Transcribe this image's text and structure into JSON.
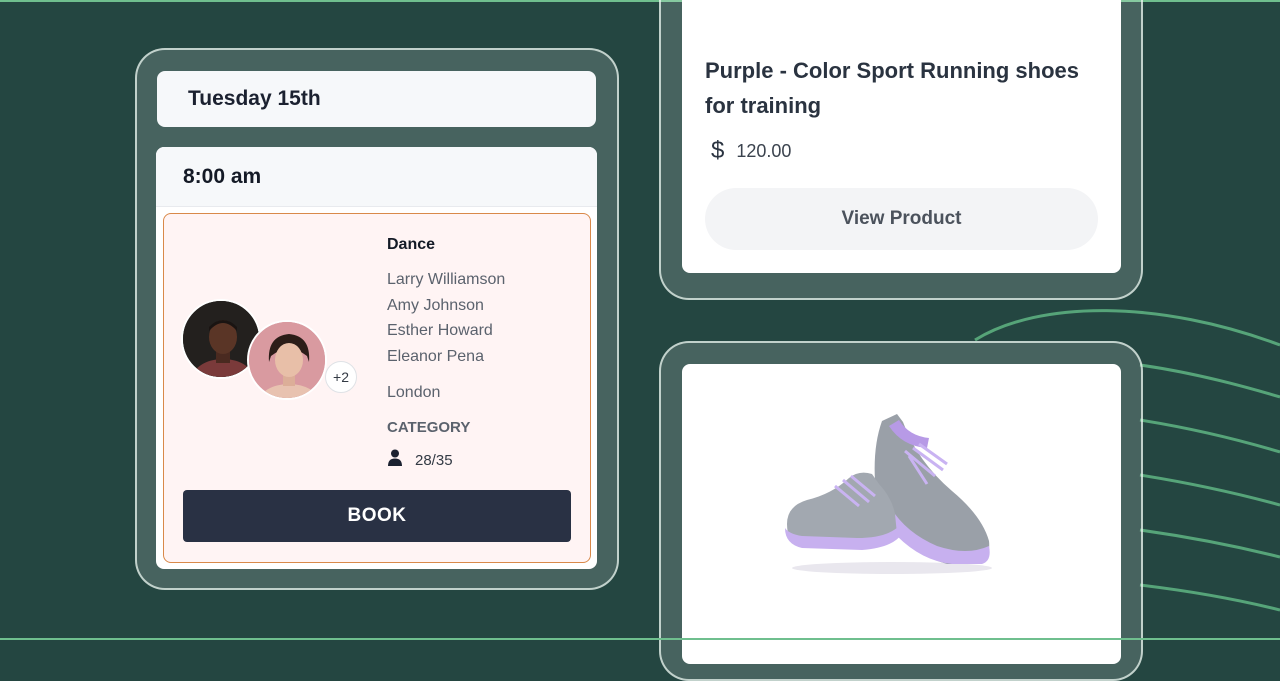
{
  "schedule": {
    "date": "Tuesday 15th",
    "time": "8:00 am",
    "session": {
      "title": "Dance",
      "instructors": [
        "Larry Williamson",
        "Amy Johnson",
        "Esther Howard",
        "Eleanor Pena"
      ],
      "location": "London",
      "category_label": "CATEGORY",
      "capacity": "28/35",
      "more_count": "+2",
      "book_label": "BOOK"
    }
  },
  "product": {
    "title": "Purple - Color Sport Running shoes for training",
    "price": "120.00",
    "view_label": "View Product",
    "image_icon": "running-shoes"
  },
  "colors": {
    "background": "#244641",
    "accent_line": "#6fbf8e",
    "book_button": "#293144",
    "session_border": "#d9894a",
    "session_bg": "#fff4f4",
    "shoe_purple": "#b79ae6",
    "shoe_gray": "#9aa0a8"
  }
}
